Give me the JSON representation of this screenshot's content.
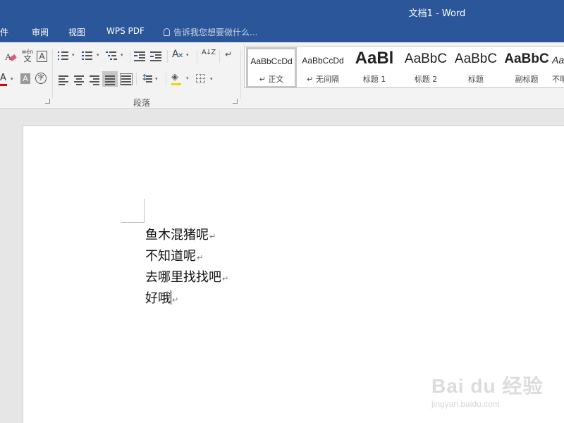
{
  "window": {
    "title": "文档1 - Word"
  },
  "tabs": [
    "邮件",
    "审阅",
    "视图",
    "WPS PDF"
  ],
  "tell_me": "告诉我您想要做什么...",
  "ribbon": {
    "phonetic_top": "wén",
    "phonetic_bottom": "文",
    "font_color_glyph": "A",
    "char_border_glyph": "A",
    "char_shading_glyph": "A",
    "enclose_glyph": "字",
    "sort_glyph": "A↓Z",
    "paragraph_group_label": "段落"
  },
  "styles": [
    {
      "preview": "AaBbCcDd",
      "name": "↵ 正文"
    },
    {
      "preview": "AaBbCcDd",
      "name": "↵ 无间隔"
    },
    {
      "preview": "AaBl",
      "name": "标题 1"
    },
    {
      "preview": "AaBbC",
      "name": "标题 2"
    },
    {
      "preview": "AaBbC",
      "name": "标题"
    },
    {
      "preview": "AaBbC",
      "name": "副标题"
    },
    {
      "preview": "AaBl",
      "name": "不明"
    }
  ],
  "document": {
    "lines": [
      "鱼木混猪呢",
      "不知道呢",
      "去哪里找找吧",
      "好哦"
    ],
    "paragraph_mark": "↵"
  },
  "watermark": {
    "main": "Bai du 经验",
    "sub": "jingyan.baidu.com"
  },
  "colors": {
    "title_bar": "#2b579a",
    "font_color_red": "#e00000",
    "highlight_yellow": "#f5d400"
  }
}
